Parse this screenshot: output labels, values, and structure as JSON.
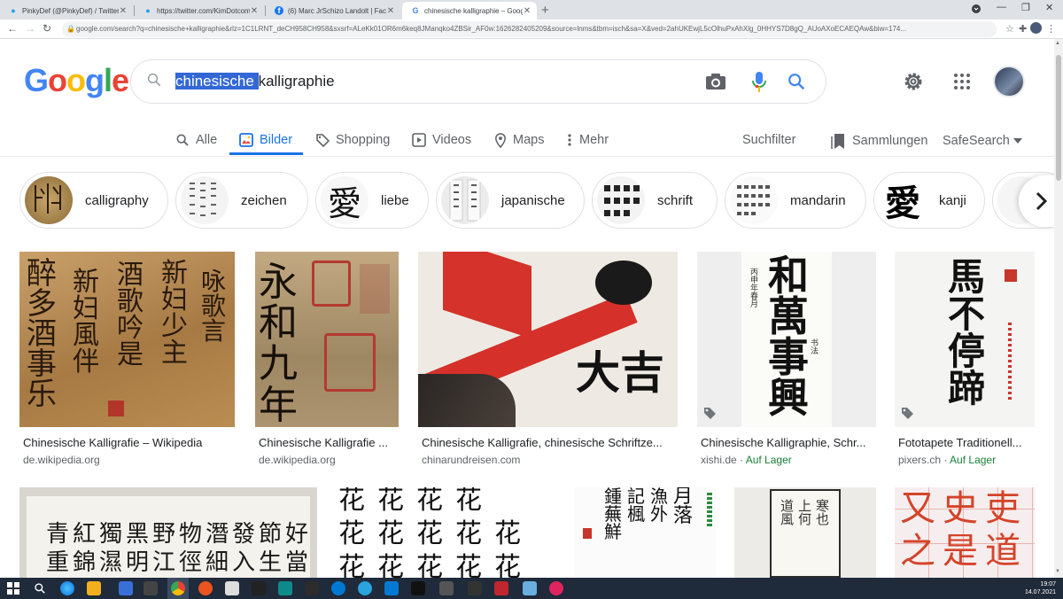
{
  "browser": {
    "tabs": [
      {
        "title": "PinkyDef (@PinkyDef) / Twitter",
        "icon": "twitter-icon"
      },
      {
        "title": "https://twitter.com/KimDotcom/s",
        "icon": "twitter-icon"
      },
      {
        "title": "(6) Marc JrSchizo Landolt | Faceb",
        "icon": "facebook-icon"
      },
      {
        "title": "chinesische kalligraphie – Google",
        "icon": "google-icon",
        "active": true
      }
    ],
    "url": "google.com/search?q=chinesische+kalligraphie&rlz=1C1LRNT_deCH958CH958&sxsrf=ALeKk01OR6m6keq8JManqko4ZBSir_AF0w:1626282405209&source=lnms&tbm=isch&sa=X&ved=2ahUKEwjL5cOlhuPxAhXlg_0HHYS7D8gQ_AUoAXoECAEQAw&biw=174..."
  },
  "logo": {
    "letters": [
      "G",
      "o",
      "o",
      "g",
      "l",
      "e"
    ],
    "colors": [
      "#4285f4",
      "#ea4335",
      "#fbbc05",
      "#4285f4",
      "#34a853",
      "#ea4335"
    ]
  },
  "search": {
    "query_selected": "chinesische ",
    "query_rest": "kalligraphie"
  },
  "nav": {
    "tabs": [
      "Alle",
      "Bilder",
      "Shopping",
      "Videos",
      "Maps",
      "Mehr"
    ],
    "tools": "Suchfilter",
    "collections": "Sammlungen",
    "safesearch": "SafeSearch"
  },
  "chips": [
    {
      "label": "calligraphy"
    },
    {
      "label": "zeichen"
    },
    {
      "label": "liebe",
      "glyph": "愛"
    },
    {
      "label": "japanische"
    },
    {
      "label": "schrift"
    },
    {
      "label": "mandarin"
    },
    {
      "label": "kanji",
      "glyph": "愛"
    }
  ],
  "results": [
    {
      "title": "Chinesische Kalligrafie – Wikipedia",
      "source": "de.wikipedia.org",
      "stock": ""
    },
    {
      "title": "Chinesische Kalligrafie ...",
      "source": "de.wikipedia.org",
      "stock": ""
    },
    {
      "title": "Chinesische Kalligrafie, chinesische Schriftze...",
      "source": "chinarundreisen.com",
      "stock": ""
    },
    {
      "title": "Chinesische Kalligraphie, Schr...",
      "source": "xishi.de",
      "stock": "Auf Lager"
    },
    {
      "title": "Fototapete Traditionell...",
      "source": "pixers.ch",
      "stock": "Auf Lager"
    }
  ],
  "images": {
    "r1": "醉多酒事乐",
    "r2": "永和九年",
    "r3": "大吉",
    "r4": "和萬事興",
    "r5": "馬不停蹄",
    "r7": "花花花花",
    "r10a": "又史吏",
    "r10b": "之是道"
  },
  "taskbar": {
    "time": "19:07",
    "date": "14.07.2021"
  }
}
